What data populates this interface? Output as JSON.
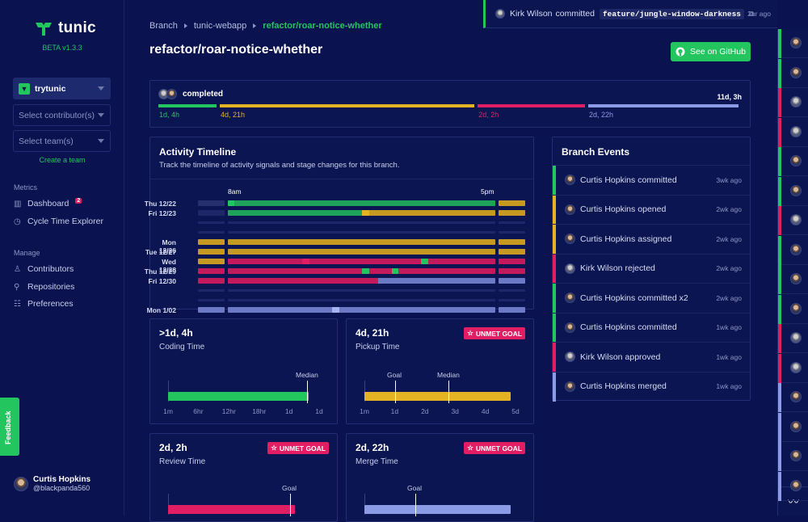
{
  "app": {
    "name": "tunic",
    "version": "BETA v1.3.3"
  },
  "sidebar": {
    "org": "trytunic",
    "contributor_placeholder": "Select contributor(s)",
    "team_placeholder": "Select team(s)",
    "create_team": "Create a team",
    "metrics_label": "Metrics",
    "manage_label": "Manage",
    "metrics": [
      {
        "label": "Dashboard",
        "badge": "2",
        "icon": "chart-icon"
      },
      {
        "label": "Cycle Time Explorer",
        "icon": "clock-icon"
      }
    ],
    "manage": [
      {
        "label": "Contributors",
        "icon": "user-icon"
      },
      {
        "label": "Repositories",
        "icon": "link-icon"
      },
      {
        "label": "Preferences",
        "icon": "sliders-icon"
      }
    ],
    "feedback": "Feedback",
    "user": {
      "name": "Curtis Hopkins",
      "handle": "@blackpanda560"
    }
  },
  "breadcrumb": [
    "Branch",
    "tunic-webapp",
    "refactor/roar-notice-whether"
  ],
  "page_title": "refactor/roar-notice-whether",
  "github_button": "See on GitHub",
  "summary": {
    "status": "completed",
    "total": "11d, 3h",
    "segments": [
      {
        "label": "1d, 4h",
        "color": "#22c55e",
        "share": 0.1
      },
      {
        "label": "4d, 21h",
        "color": "#e3b324",
        "share": 0.42
      },
      {
        "label": "2d, 2h",
        "color": "#e11d63",
        "share": 0.18
      },
      {
        "label": "2d, 22h",
        "color": "#8b9be6",
        "share": 0.25
      }
    ]
  },
  "timeline": {
    "title": "Activity Timeline",
    "subtitle": "Track the timeline of activity signals and stage changes for this branch.",
    "start_label": "8am",
    "end_label": "5pm",
    "days": [
      "Thu 12/22",
      "Fri 12/23",
      "",
      "",
      "Mon 12/26",
      "Tue 12/27",
      "Wed 12/28",
      "Thu 12/29",
      "Fri 12/30",
      "",
      "",
      "Mon 1/02"
    ]
  },
  "events": {
    "title": "Branch Events",
    "items": [
      {
        "user": "Curtis Hopkins",
        "action": "committed",
        "ago": "3wk ago",
        "color": "#22c55e"
      },
      {
        "user": "Curtis Hopkins",
        "action": "opened",
        "ago": "2wk ago",
        "color": "#e3b324"
      },
      {
        "user": "Curtis Hopkins",
        "action": "assigned",
        "ago": "2wk ago",
        "color": "#e3b324"
      },
      {
        "user": "Kirk Wilson",
        "action": "rejected",
        "ago": "2wk ago",
        "color": "#e11d63"
      },
      {
        "user": "Curtis Hopkins",
        "action": "committed x2",
        "ago": "2wk ago",
        "color": "#22c55e"
      },
      {
        "user": "Curtis Hopkins",
        "action": "committed",
        "ago": "1wk ago",
        "color": "#22c55e"
      },
      {
        "user": "Kirk Wilson",
        "action": "approved",
        "ago": "1wk ago",
        "color": "#e11d63"
      },
      {
        "user": "Curtis Hopkins",
        "action": "merged",
        "ago": "1wk ago",
        "color": "#8b9be6"
      }
    ]
  },
  "cards": [
    {
      "value": ">1d, 4h",
      "label": "Coding Time",
      "color": "#22c55e",
      "badge": "",
      "marker": "Median",
      "fill": 0.94,
      "ticks": [
        "1m",
        "6hr",
        "12hr",
        "18hr",
        "1d",
        "1d"
      ]
    },
    {
      "value": "4d, 21h",
      "label": "Pickup Time",
      "color": "#e3b324",
      "badge": "UNMET GOAL",
      "marker": "Goal",
      "marker2": "Median",
      "fill": 0.98,
      "ticks": [
        "1m",
        "1d",
        "2d",
        "3d",
        "4d",
        "5d"
      ]
    },
    {
      "value": "2d, 2h",
      "label": "Review Time",
      "color": "#e11d63",
      "badge": "UNMET GOAL",
      "marker": "Goal",
      "fill": 0.85,
      "ticks": []
    },
    {
      "value": "2d, 22h",
      "label": "Merge Time",
      "color": "#8b9be6",
      "badge": "UNMET GOAL",
      "marker": "Goal",
      "fill": 0.98,
      "ticks": []
    }
  ],
  "toast": {
    "user": "Kirk Wilson",
    "action": "committed",
    "branch": "feature/jungle-window-darkness",
    "ago": "2hr ago"
  },
  "rail": [
    "#22c55e",
    "#22c55e",
    "#e11d63",
    "#e11d63",
    "#22c55e",
    "#22c55e",
    "#e11d63",
    "#22c55e",
    "#22c55e",
    "#22c55e",
    "#e11d63",
    "#e11d63",
    "#8b9be6",
    "#8b9be6",
    "#8b9be6",
    "#8b9be6"
  ]
}
